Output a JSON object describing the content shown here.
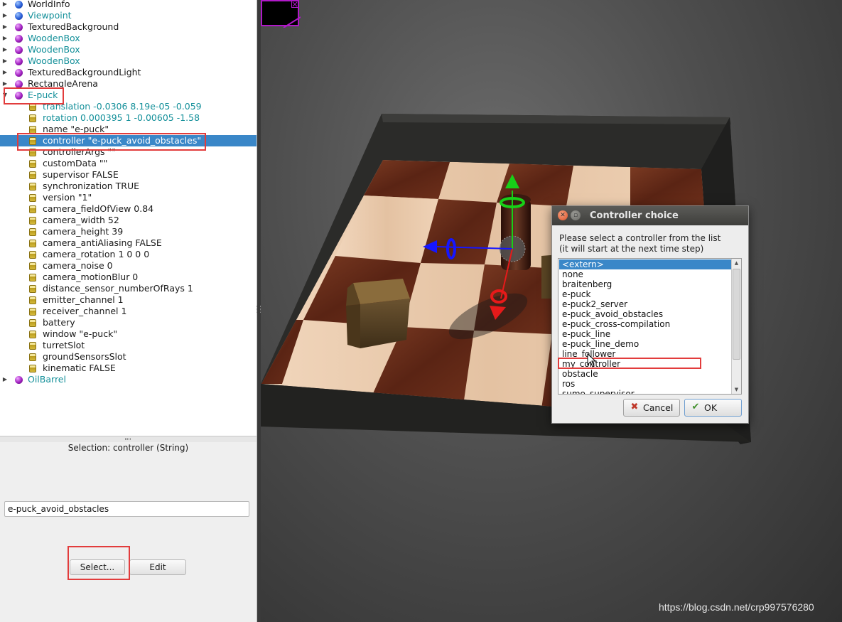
{
  "scene_tree": {
    "rows": [
      {
        "expander": "collapsed",
        "icon": "blue-sphere",
        "label": "WorldInfo",
        "color": "dark"
      },
      {
        "expander": "collapsed",
        "icon": "blue-sphere",
        "label": "Viewpoint",
        "color": "teal"
      },
      {
        "expander": "collapsed",
        "icon": "purple-sphere",
        "label": "TexturedBackground",
        "color": "dark"
      },
      {
        "expander": "collapsed",
        "icon": "purple-sphere",
        "label": "WoodenBox",
        "color": "teal"
      },
      {
        "expander": "collapsed",
        "icon": "purple-sphere",
        "label": "WoodenBox",
        "color": "teal"
      },
      {
        "expander": "collapsed",
        "icon": "purple-sphere",
        "label": "WoodenBox",
        "color": "teal"
      },
      {
        "expander": "collapsed",
        "icon": "purple-sphere",
        "label": "TexturedBackgroundLight",
        "color": "dark"
      },
      {
        "expander": "collapsed",
        "icon": "purple-sphere",
        "label": "RectangleArena",
        "color": "dark"
      },
      {
        "expander": "expanded",
        "icon": "purple-sphere",
        "label": "E-puck",
        "color": "teal"
      },
      {
        "expander": "none",
        "icon": "field-cylinder",
        "label": "translation -0.0306 8.19e-05 -0.059",
        "color": "teal"
      },
      {
        "expander": "none",
        "icon": "field-cylinder",
        "label": "rotation 0.000395 1 -0.00605 -1.58",
        "color": "teal"
      },
      {
        "expander": "none",
        "icon": "field-cylinder",
        "label": "name \"e-puck\"",
        "color": "dark"
      },
      {
        "expander": "none",
        "icon": "field-cylinder",
        "label": "controller \"e-puck_avoid_obstacles\"",
        "color": "dark",
        "selected": true
      },
      {
        "expander": "none",
        "icon": "field-cylinder",
        "label": "controllerArgs \"\"",
        "color": "dark"
      },
      {
        "expander": "none",
        "icon": "field-cylinder",
        "label": "customData \"\"",
        "color": "dark"
      },
      {
        "expander": "none",
        "icon": "field-cylinder",
        "label": "supervisor FALSE",
        "color": "dark"
      },
      {
        "expander": "none",
        "icon": "field-cylinder",
        "label": "synchronization TRUE",
        "color": "dark"
      },
      {
        "expander": "none",
        "icon": "field-cylinder",
        "label": "version \"1\"",
        "color": "dark"
      },
      {
        "expander": "none",
        "icon": "field-cylinder",
        "label": "camera_fieldOfView 0.84",
        "color": "dark"
      },
      {
        "expander": "none",
        "icon": "field-cylinder",
        "label": "camera_width 52",
        "color": "dark"
      },
      {
        "expander": "none",
        "icon": "field-cylinder",
        "label": "camera_height 39",
        "color": "dark"
      },
      {
        "expander": "none",
        "icon": "field-cylinder",
        "label": "camera_antiAliasing FALSE",
        "color": "dark"
      },
      {
        "expander": "none",
        "icon": "field-cylinder",
        "label": "camera_rotation 1 0 0 0",
        "color": "dark"
      },
      {
        "expander": "none",
        "icon": "field-cylinder",
        "label": "camera_noise 0",
        "color": "dark"
      },
      {
        "expander": "none",
        "icon": "field-cylinder",
        "label": "camera_motionBlur 0",
        "color": "dark"
      },
      {
        "expander": "none",
        "icon": "field-cylinder",
        "label": "distance_sensor_numberOfRays 1",
        "color": "dark"
      },
      {
        "expander": "none",
        "icon": "field-cylinder",
        "label": "emitter_channel 1",
        "color": "dark"
      },
      {
        "expander": "none",
        "icon": "field-cylinder",
        "label": "receiver_channel 1",
        "color": "dark"
      },
      {
        "expander": "none",
        "icon": "field-cylinder",
        "label": "battery",
        "color": "dark"
      },
      {
        "expander": "none",
        "icon": "field-cylinder",
        "label": "window \"e-puck\"",
        "color": "dark"
      },
      {
        "expander": "none",
        "icon": "field-cylinder",
        "label": "turretSlot",
        "color": "dark"
      },
      {
        "expander": "none",
        "icon": "field-cylinder",
        "label": "groundSensorsSlot",
        "color": "dark"
      },
      {
        "expander": "none",
        "icon": "field-cylinder",
        "label": "kinematic FALSE",
        "color": "dark"
      },
      {
        "expander": "collapsed",
        "icon": "purple-sphere",
        "label": "OilBarrel",
        "color": "teal"
      }
    ]
  },
  "field_editor": {
    "selection_title": "Selection: controller (String)",
    "controller_value": "e-puck_avoid_obstacles",
    "select_label": "Select...",
    "edit_label": "Edit"
  },
  "dialog": {
    "title": "Controller choice",
    "message_line1": "Please select a controller from the list",
    "message_line2": "(it will start at the next time step)",
    "items": [
      "<extern>",
      "none",
      "braitenberg",
      "e-puck",
      "e-puck2_server",
      "e-puck_avoid_obstacles",
      "e-puck_cross-compilation",
      "e-puck_line",
      "e-puck_line_demo",
      "line_follower",
      "my_controller",
      "obstacle",
      "ros",
      "sumo_supervisor"
    ],
    "selected_item": "<extern>",
    "cancel_label": "Cancel",
    "ok_label": "OK"
  },
  "watermark": "https://blog.csdn.net/crp997576280",
  "colors": {
    "selection": "#3a87c8",
    "teal_text": "#14909a",
    "highlight_red": "#e23c3c",
    "dark_square": "#5a2414",
    "light_square": "#e9c9ac",
    "arena_wall": "#2e2e2c"
  }
}
